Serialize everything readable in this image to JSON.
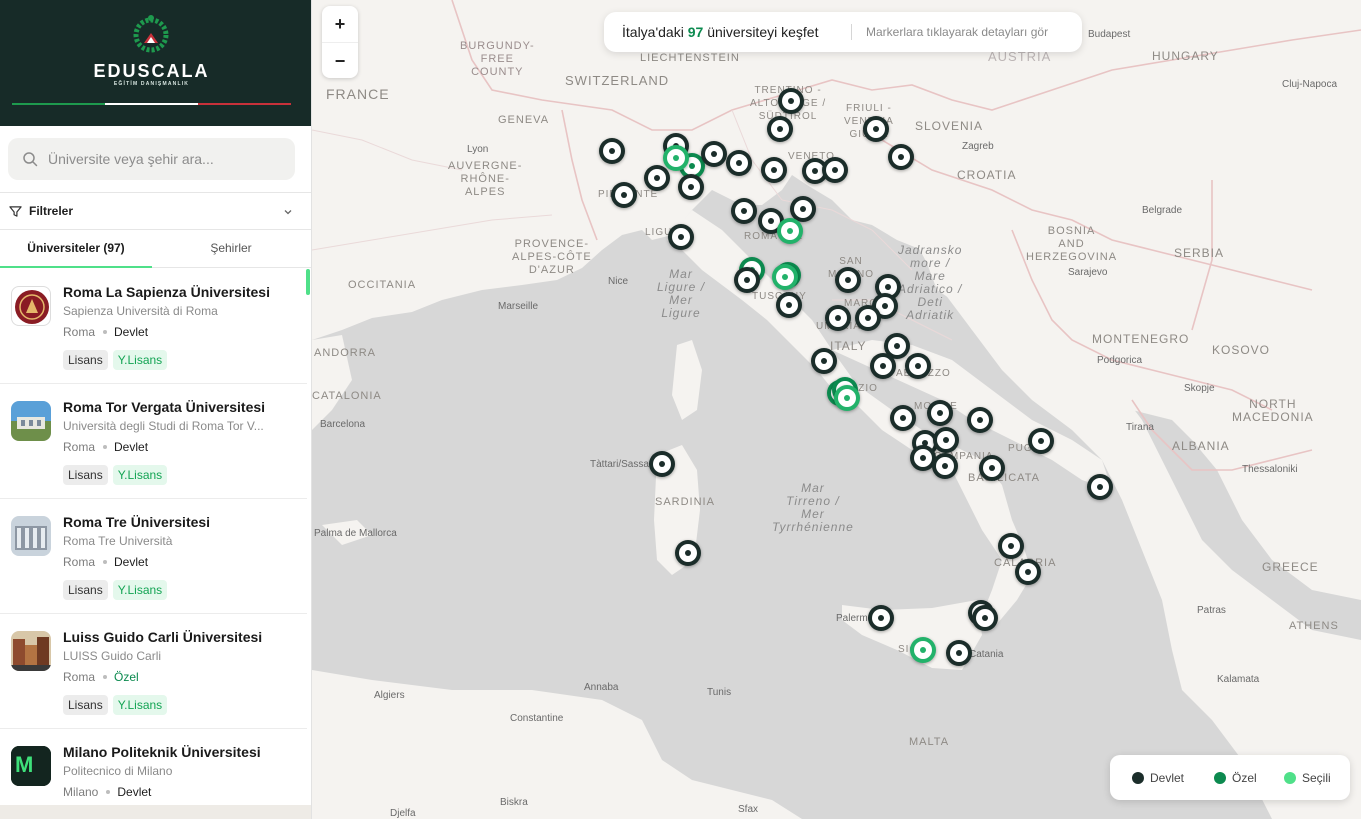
{
  "brand": {
    "name": "EDUSCALA",
    "subtitle": "EĞİTİM DANIŞMANLIK",
    "stripe_colors": [
      "#1e9a4e",
      "#ffffff",
      "#c8313a"
    ]
  },
  "search": {
    "placeholder": "Üniversite veya şehir ara..."
  },
  "filters": {
    "label": "Filtreler"
  },
  "tabs": [
    {
      "label": "Üniversiteler (97)",
      "active": true
    },
    {
      "label": "Şehirler",
      "active": false
    }
  ],
  "universities": [
    {
      "name": "Roma La Sapienza Üniversitesi",
      "subtitle": "Sapienza Università di Roma",
      "city": "Roma",
      "type": "Devlet",
      "badges": [
        "Lisans",
        "Y.Lisans"
      ]
    },
    {
      "name": "Roma Tor Vergata Üniversitesi",
      "subtitle": "Università degli Studi di Roma Tor V...",
      "city": "Roma",
      "type": "Devlet",
      "badges": [
        "Lisans",
        "Y.Lisans"
      ]
    },
    {
      "name": "Roma Tre Üniversitesi",
      "subtitle": "Roma Tre Università",
      "city": "Roma",
      "type": "Devlet",
      "badges": [
        "Lisans",
        "Y.Lisans"
      ]
    },
    {
      "name": "Luiss Guido Carli Üniversitesi",
      "subtitle": "LUISS Guido Carli",
      "city": "Roma",
      "type": "Özel",
      "badges": [
        "Lisans",
        "Y.Lisans"
      ]
    },
    {
      "name": "Milano Politeknik Üniversitesi",
      "subtitle": "Politecnico di Milano",
      "city": "Milano",
      "type": "Devlet",
      "badges": []
    }
  ],
  "map": {
    "zoom_in": "+",
    "zoom_out": "−",
    "info": {
      "prefix": "İtalya'daki",
      "count": "97",
      "suffix": "üniversiteyi keşfet",
      "hint": "Markerlara tıklayarak detayları gör"
    },
    "legend": [
      {
        "label": "Devlet",
        "color": "#1b2d2a"
      },
      {
        "label": "Özel",
        "color": "#0c8a4f"
      },
      {
        "label": "Seçili",
        "color": "#4fe089"
      }
    ],
    "regions": [
      "FRANCE",
      "BURGUNDY-\nFREE\nCOUNTY",
      "SWITZERLAND",
      "LIECHTENSTEIN",
      "AUSTRIA",
      "HUNGARY",
      "SLOVENIA",
      "CROATIA",
      "BOSNIA\nAND\nHERZEGOVINA",
      "SERBIA",
      "MONTENEGRO",
      "KOSOVO",
      "NORTH\nMACEDONIA",
      "ALBANIA",
      "GREECE",
      "ATHENS",
      "PROVENCE-\nALPES-CÔTE\nD'AZUR",
      "OCCITANIA",
      "AUVERGNE-\nRHÔNE-\nALPES",
      "GENEVA",
      "ANDORRA",
      "CATALONIA",
      "SARDINIA",
      "ITALY",
      "MALTA",
      "TRENTINO -\nALTO ADIGE /\nSÜDTIROL",
      "FRIULI -\nVENEZIA\nGIULIA",
      "VENETO",
      "SAN\nMARINO",
      "TUSCANY",
      "PIEMONTE",
      "LIGURIA",
      "ROMAGNA",
      "UMBRIA",
      "MARCHE",
      "LAZIO",
      "ABRUZZO",
      "MOLISE",
      "CAMPANIA",
      "PUGLIA",
      "BASILICATA",
      "CALABRIA",
      "SICILY"
    ],
    "seas": [
      "Mar\nLigure /\nMer\nLigure",
      "Jadransko\nmore /\nMare\nAdriatico /\nDeti\nAdriatik",
      "Mar\nTirreno /\nMer\nTyrrhénienne"
    ],
    "cities": [
      "Budapest",
      "Cluj-Napoca",
      "Zagreb",
      "Belgrade",
      "Sarajevo",
      "Podgorica",
      "Skopje",
      "Tirana",
      "Thessaloniki",
      "Patras",
      "Kalamata",
      "Lyon",
      "Nice",
      "Marseille",
      "Barcelona",
      "Palma de Mallorca",
      "Algiers",
      "Annaba",
      "Tunis",
      "Constantine",
      "Biskra",
      "Sfax",
      "Djelfa",
      "Tàttari/Sassari",
      "Palermo",
      "Catania"
    ]
  }
}
